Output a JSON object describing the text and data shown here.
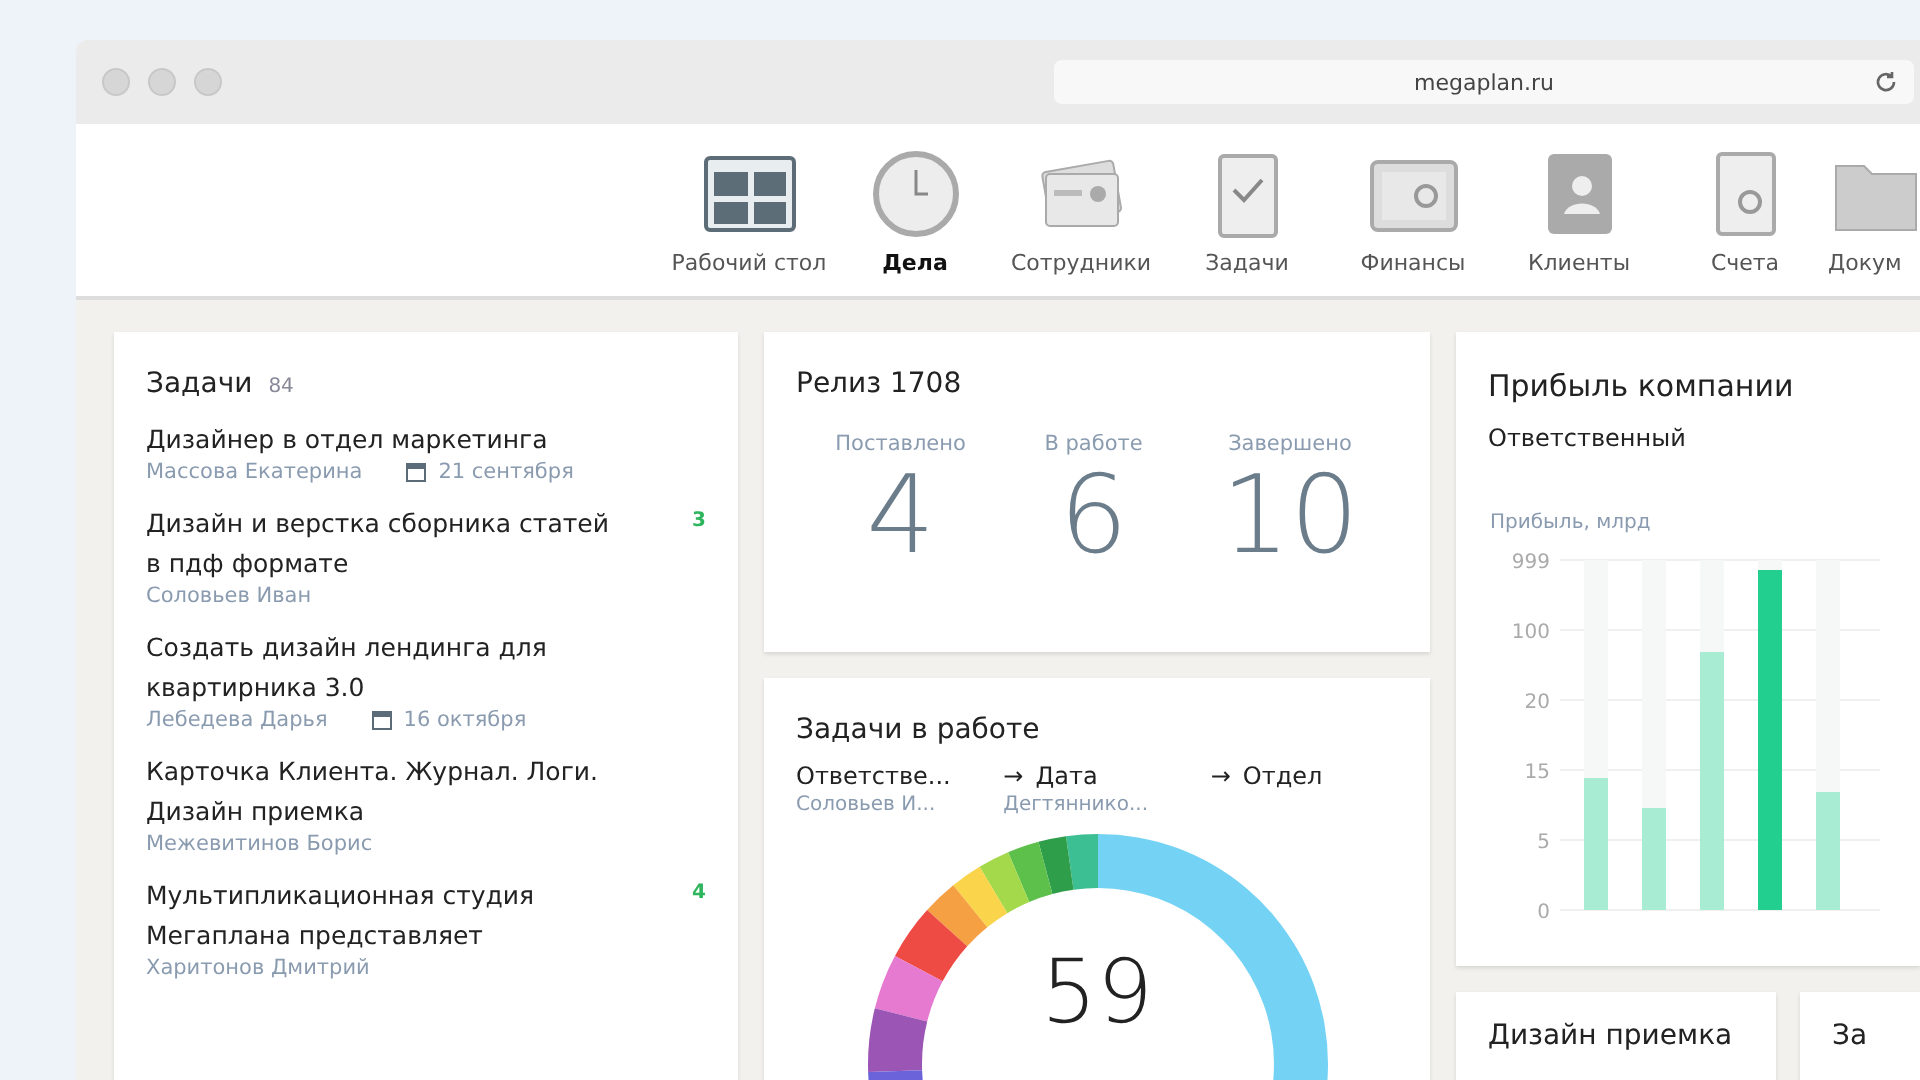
{
  "browser": {
    "url": "megaplan.ru"
  },
  "nav": [
    {
      "label": "Рабочий стол",
      "selected": false
    },
    {
      "label": "Дела",
      "selected": true
    },
    {
      "label": "Сотрудники",
      "selected": false
    },
    {
      "label": "Задачи",
      "selected": false
    },
    {
      "label": "Финансы",
      "selected": false
    },
    {
      "label": "Клиенты",
      "selected": false
    },
    {
      "label": "Счета",
      "selected": false
    },
    {
      "label": "Докум",
      "selected": false
    }
  ],
  "tasks": {
    "title": "Задачи",
    "count": "84",
    "items": [
      {
        "title": "Дизайнер в отдел маркетинга",
        "person": "Массова Екатерина",
        "date": "21 сентября"
      },
      {
        "title": "Дизайн и верстка сборника статей в пдф формате",
        "person": "Соловьев Иван",
        "badge": "3"
      },
      {
        "title": "Создать дизайн лендинга для квартирника 3.0",
        "person": "Лебедева Дарья",
        "date": "16 октября"
      },
      {
        "title": "Карточка Клиента. Журнал. Логи. Дизайн приемка",
        "person": "Межевитинов Борис"
      },
      {
        "title": "Мультипликационная студия Мегаплана представляет",
        "person": "Харитонов Дмитрий",
        "badge": "4"
      }
    ]
  },
  "release": {
    "title": "Релиз 1708",
    "stats": [
      {
        "label": "Поставлено",
        "value": "4"
      },
      {
        "label": "В работе",
        "value": "6"
      },
      {
        "label": "Завершено",
        "value": "10"
      }
    ]
  },
  "in_progress": {
    "title": "Задачи в работе",
    "columns": [
      {
        "label": "Ответстве...",
        "value": "Соловьев И..."
      },
      {
        "arrow": "→",
        "label": "Дата",
        "value": "Дегтяннико..."
      },
      {
        "arrow": "→",
        "label": "Отдел"
      }
    ],
    "total": "59"
  },
  "profit": {
    "title": "Прибыль компании",
    "subtitle": "Ответственный",
    "axis_label": "Прибыль, млрд",
    "axis_ticks": [
      "999",
      "100",
      "20",
      "15",
      "5",
      "0"
    ],
    "bars": [
      {
        "level": 0.38,
        "selected": false
      },
      {
        "level": 0.29,
        "selected": false
      },
      {
        "level": 0.74,
        "selected": false
      },
      {
        "level": 0.97,
        "selected": true
      },
      {
        "level": 0.34,
        "selected": false
      }
    ]
  },
  "bottom_cards": [
    {
      "title": "Дизайн приемка"
    },
    {
      "title": "За"
    }
  ]
}
